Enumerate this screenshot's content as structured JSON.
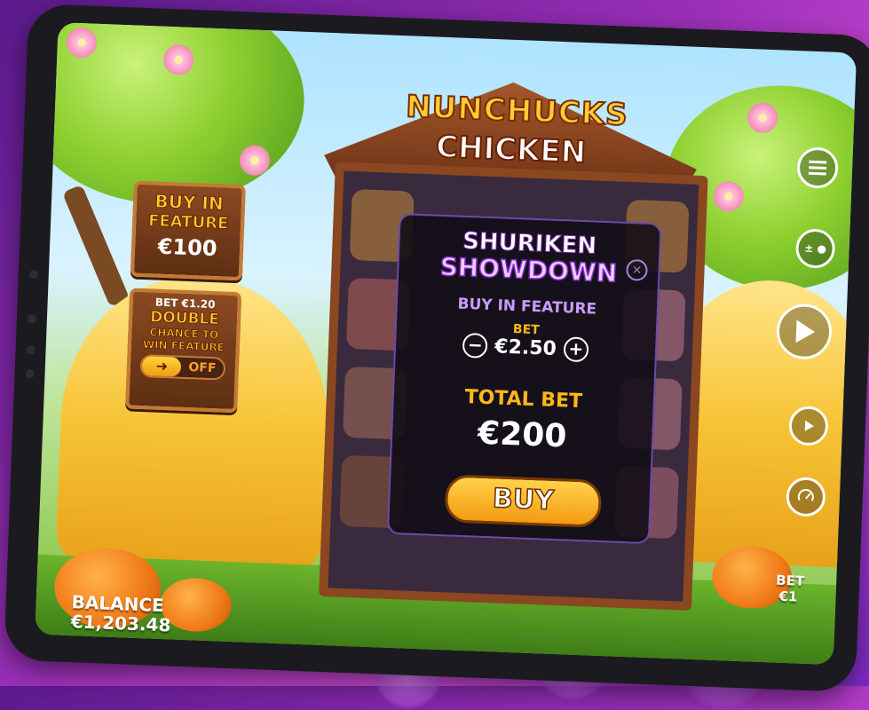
{
  "game": {
    "title_line1": "NUNCHUCKS",
    "title_line2": "CHICKEN"
  },
  "buy_feature_panel": {
    "title_line1": "BUY IN",
    "title_line2": "FEATURE",
    "price": "€100"
  },
  "double_chance_panel": {
    "bet_label": "BET €1.20",
    "title_line1": "DOUBLE",
    "title_line2": "CHANCE TO",
    "title_line3": "WIN FEATURE",
    "toggle_arrow": "➜",
    "toggle_state": "OFF"
  },
  "modal": {
    "title_line1": "SHURIKEN",
    "title_line2": "SHOWDOWN",
    "close_symbol": "×",
    "subtitle": "BUY IN FEATURE",
    "bet_label": "BET",
    "bet_value": "€2.50",
    "minus_symbol": "−",
    "plus_symbol": "+",
    "total_bet_label": "TOTAL BET",
    "total_bet_value": "€200",
    "buy_label": "BUY"
  },
  "hud": {
    "balance_label": "BALANCE",
    "balance_value": "€1,203.48",
    "bet_label": "BET",
    "bet_value": "€1"
  },
  "controls": {
    "menu_icon": "menu-icon",
    "bet_adjust_icon": "coin-stack-icon",
    "spin_icon": "play-icon",
    "autoplay_icon": "autoplay-icon",
    "turbo_icon": "speedometer-icon"
  },
  "colors": {
    "accent_gold": "#ffcf2e",
    "modal_purple": "#c99bff",
    "background_purple": "#9a2fb8"
  }
}
